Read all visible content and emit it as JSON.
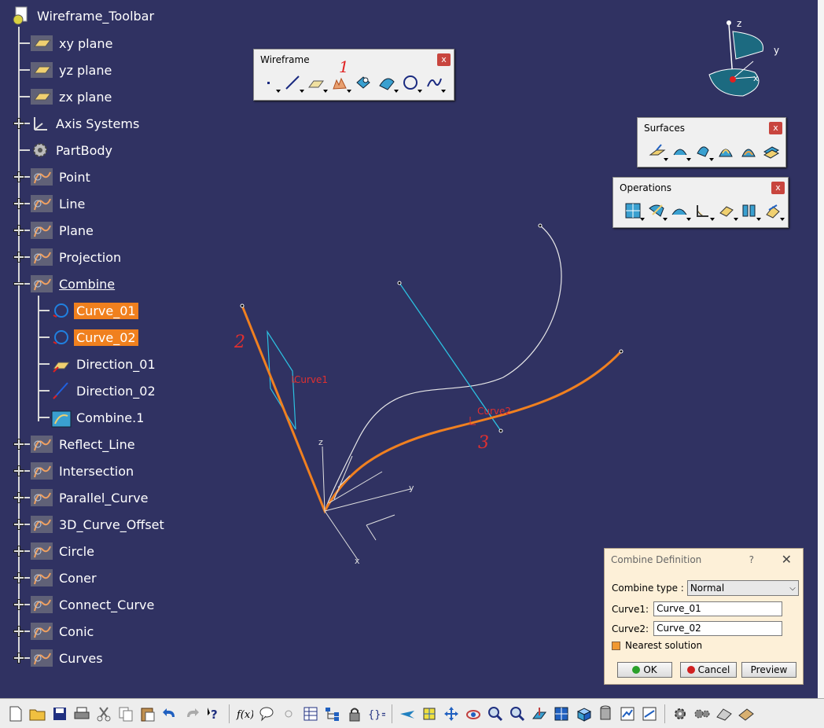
{
  "tree": {
    "root": "Wireframe_Toolbar",
    "items": [
      {
        "label": "xy plane",
        "icon": "plane-icon"
      },
      {
        "label": "yz plane",
        "icon": "plane-icon"
      },
      {
        "label": "zx plane",
        "icon": "plane-icon"
      },
      {
        "label": "Axis Systems",
        "icon": "axis-system-icon"
      },
      {
        "label": "PartBody",
        "icon": "gear-icon"
      },
      {
        "label": "Point",
        "icon": "geometrical-set-icon"
      },
      {
        "label": "Line",
        "icon": "geometrical-set-icon"
      },
      {
        "label": "Plane",
        "icon": "geometrical-set-icon"
      },
      {
        "label": "Projection",
        "icon": "geometrical-set-icon"
      },
      {
        "label": "Combine",
        "icon": "geometrical-set-icon"
      },
      {
        "label": "Curve_01",
        "icon": "curve-icon"
      },
      {
        "label": "Curve_02",
        "icon": "curve-icon"
      },
      {
        "label": "Direction_01",
        "icon": "plane-direction-icon"
      },
      {
        "label": "Direction_02",
        "icon": "line-direction-icon"
      },
      {
        "label": "Combine.1",
        "icon": "combine-icon"
      },
      {
        "label": "Reflect_Line",
        "icon": "geometrical-set-icon"
      },
      {
        "label": "Intersection",
        "icon": "geometrical-set-icon"
      },
      {
        "label": "Parallel_Curve",
        "icon": "geometrical-set-icon"
      },
      {
        "label": "3D_Curve_Offset",
        "icon": "geometrical-set-icon"
      },
      {
        "label": "Circle",
        "icon": "geometrical-set-icon"
      },
      {
        "label": "Coner",
        "icon": "geometrical-set-icon"
      },
      {
        "label": "Connect_Curve",
        "icon": "geometrical-set-icon"
      },
      {
        "label": "Conic",
        "icon": "geometrical-set-icon"
      },
      {
        "label": "Curves",
        "icon": "geometrical-set-icon"
      }
    ]
  },
  "toolbars": {
    "wireframe": {
      "title": "Wireframe",
      "close": "x",
      "annotation": "1"
    },
    "surfaces": {
      "title": "Surfaces",
      "close": "x"
    },
    "operations": {
      "title": "Operations",
      "close": "x"
    }
  },
  "viewport": {
    "compass": {
      "z": "z",
      "y": "y",
      "x": "x"
    },
    "axes": {
      "z": "z",
      "y": "y",
      "x": "x"
    },
    "labels": {
      "curve1": "Curve1",
      "curve2": "Curve2"
    },
    "annotations": {
      "a2": "2",
      "a3": "3"
    },
    "colors": {
      "background": "#303262",
      "combine_curve": "#f08020",
      "direction_line": "#2cc0e0",
      "annotation": "#e03030"
    }
  },
  "dialog": {
    "title": "Combine Definition",
    "help": "?",
    "combine_type_label": "Combine type :",
    "combine_type_value": "Normal",
    "curve1_label": "Curve1:",
    "curve1_value": "Curve_01",
    "curve2_label": "Curve2:",
    "curve2_value": "Curve_02",
    "nearest_label": "Nearest solution",
    "ok": "OK",
    "cancel": "Cancel",
    "preview": "Preview"
  }
}
